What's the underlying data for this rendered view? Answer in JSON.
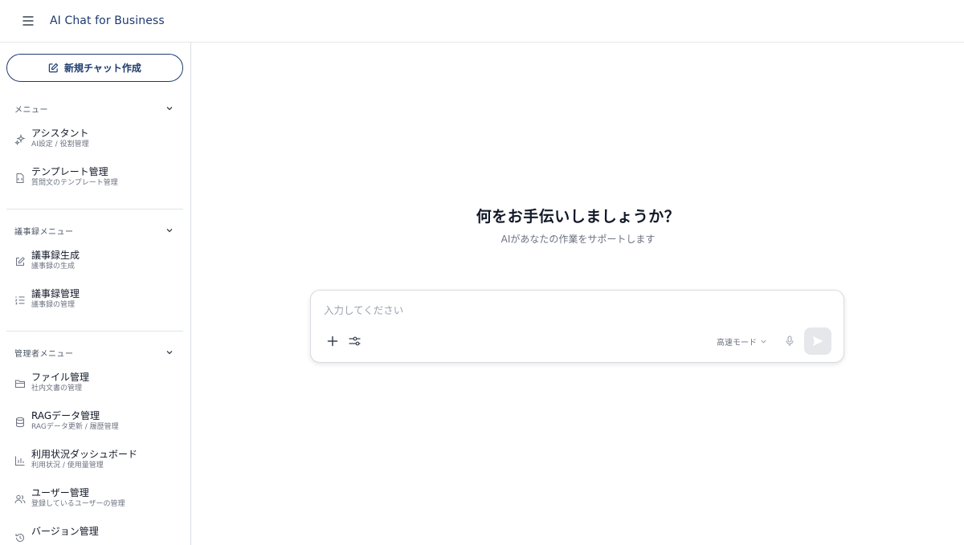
{
  "header": {
    "app_title": "AI Chat for Business"
  },
  "sidebar": {
    "new_chat_label": "新規チャット作成",
    "sections": [
      {
        "title": "メニュー",
        "items": [
          {
            "label": "アシスタント",
            "sub": "AI設定 / 役割管理",
            "icon": "sparkle-icon"
          },
          {
            "label": "テンプレート管理",
            "sub": "質問文のテンプレート管理",
            "icon": "template-icon"
          }
        ]
      },
      {
        "title": "議事録メニュー",
        "items": [
          {
            "label": "議事録生成",
            "sub": "議事録の生成",
            "icon": "edit-icon"
          },
          {
            "label": "議事録管理",
            "sub": "議事録の管理",
            "icon": "list-icon"
          }
        ]
      },
      {
        "title": "管理者メニュー",
        "items": [
          {
            "label": "ファイル管理",
            "sub": "社内文書の管理",
            "icon": "folder-icon"
          },
          {
            "label": "RAGデータ管理",
            "sub": "RAGデータ更新 / 履歴管理",
            "icon": "database-icon"
          },
          {
            "label": "利用状況ダッシュボード",
            "sub": "利用状況 / 使用量管理",
            "icon": "bar-chart-icon"
          },
          {
            "label": "ユーザー管理",
            "sub": "登録しているユーザーの管理",
            "icon": "users-icon"
          },
          {
            "label": "バージョン管理",
            "sub": "",
            "icon": "history-icon"
          }
        ]
      }
    ]
  },
  "main": {
    "heading": "何をお手伝いしましょうか？",
    "subheading": "AIがあなたの作業をサポートします",
    "input_placeholder": "入力してください",
    "mode_label": "高速モード"
  },
  "colors": {
    "accent": "#1e3a6e",
    "send_disabled": "#e5e7eb"
  }
}
